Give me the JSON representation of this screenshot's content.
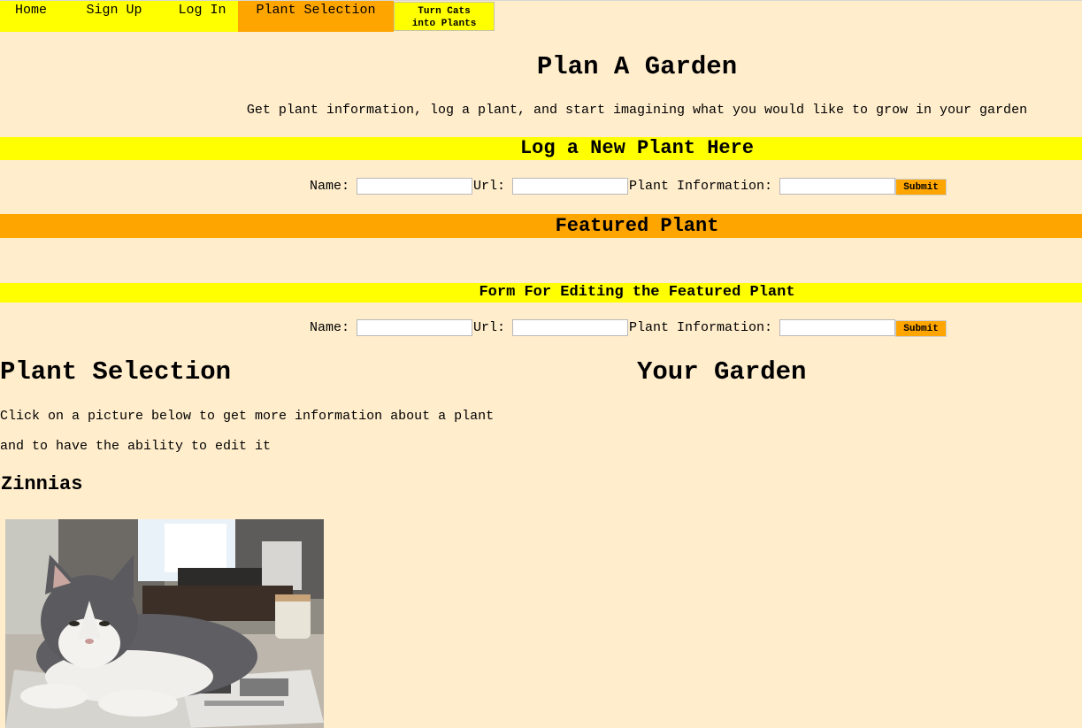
{
  "nav": {
    "items": [
      {
        "label": "Home"
      },
      {
        "label": "Sign Up"
      },
      {
        "label": "Log In"
      },
      {
        "label": "Plant Selection",
        "active": true
      }
    ],
    "button_line1": "Turn Cats",
    "button_line2": "into Plants"
  },
  "header": {
    "title": "Plan A Garden",
    "subtitle": "Get plant information, log a plant, and start imagining what you would like to grow in your garden"
  },
  "log_plant": {
    "heading": "Log a New Plant Here",
    "name_label": "Name:",
    "url_label": "Url:",
    "info_label": "Plant Information:",
    "name_value": "",
    "url_value": "",
    "info_value": "",
    "submit_label": "Submit"
  },
  "featured": {
    "heading": "Featured Plant"
  },
  "edit_featured": {
    "heading": "Form For Editing the Featured Plant",
    "name_label": "Name:",
    "url_label": "Url:",
    "info_label": "Plant Information:",
    "name_value": "",
    "url_value": "",
    "info_value": "",
    "submit_label": "Submit"
  },
  "plant_selection": {
    "heading": "Plant Selection",
    "description_line1": "Click on a picture below to get more information about a plant",
    "description_line2": "and to have the ability to edit it",
    "plants": [
      {
        "name": "Zinnias"
      }
    ]
  },
  "garden": {
    "heading": "Your Garden"
  },
  "colors": {
    "background": "#ffedcc",
    "yellow": "#ffff00",
    "orange": "#ffa500"
  }
}
